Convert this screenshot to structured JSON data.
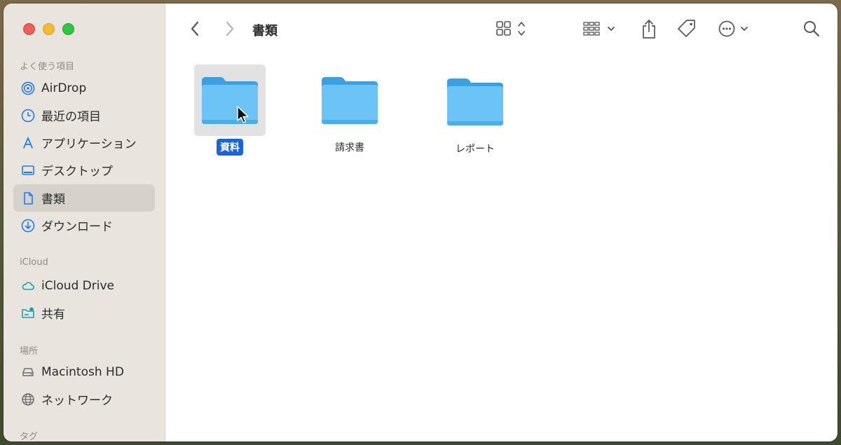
{
  "window": {
    "title": "書類"
  },
  "sidebar": {
    "sections": [
      {
        "title": "よく使う項目"
      },
      {
        "title": "iCloud"
      },
      {
        "title": "場所"
      },
      {
        "title": "タグ"
      }
    ],
    "favorites": [
      {
        "label": "AirDrop",
        "icon": "airdrop-icon"
      },
      {
        "label": "最近の項目",
        "icon": "clock-icon"
      },
      {
        "label": "アプリケーション",
        "icon": "applications-icon"
      },
      {
        "label": "デスクトップ",
        "icon": "desktop-icon"
      },
      {
        "label": "書類",
        "icon": "document-icon",
        "selected": true
      },
      {
        "label": "ダウンロード",
        "icon": "download-icon"
      }
    ],
    "icloud": [
      {
        "label": "iCloud Drive",
        "icon": "cloud-icon"
      },
      {
        "label": "共有",
        "icon": "shared-folder-icon"
      }
    ],
    "locations": [
      {
        "label": "Macintosh HD",
        "icon": "drive-icon"
      },
      {
        "label": "ネットワーク",
        "icon": "network-icon"
      }
    ]
  },
  "files": [
    {
      "name": "資料",
      "selected": true
    },
    {
      "name": "請求書",
      "selected": false
    },
    {
      "name": "レポート",
      "selected": false
    }
  ],
  "colors": {
    "accent": "#1b64d8",
    "folder": "#6cc3f5",
    "sidebar_bg": "#e9e4de"
  }
}
